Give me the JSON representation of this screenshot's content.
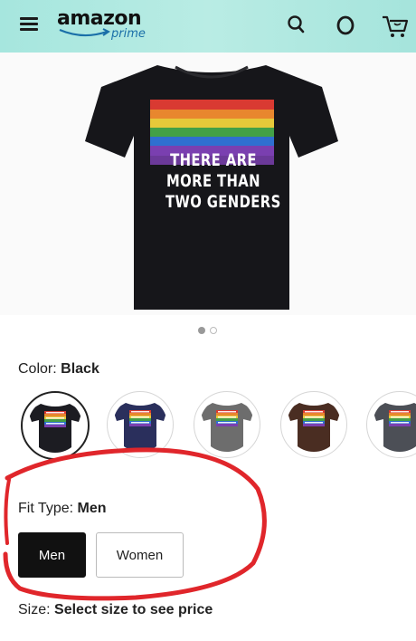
{
  "header": {
    "logo_word": "amazon",
    "logo_sub": "prime",
    "icons": [
      "menu-icon",
      "search-icon",
      "alexa-ring-icon",
      "cart-icon"
    ]
  },
  "product_image": {
    "shirt_text": [
      "THERE ARE",
      "MORE THAN",
      "TWO GENDERS"
    ],
    "carousel": {
      "count": 2,
      "active_index": 0
    }
  },
  "color": {
    "label": "Color:",
    "value": "Black",
    "swatches": [
      {
        "name": "Black",
        "hex": "#1c1c22",
        "selected": true
      },
      {
        "name": "Navy",
        "hex": "#2a2f5c",
        "selected": false
      },
      {
        "name": "Gray",
        "hex": "#6d6d6d",
        "selected": false
      },
      {
        "name": "Brown",
        "hex": "#4a2d22",
        "selected": false
      },
      {
        "name": "Dark Gray",
        "hex": "#4c4f56",
        "selected": false
      }
    ]
  },
  "fit_type": {
    "label": "Fit Type:",
    "value": "Men",
    "options": [
      {
        "label": "Men",
        "selected": true
      },
      {
        "label": "Women",
        "selected": false
      }
    ]
  },
  "size": {
    "label": "Size:",
    "value": "Select size to see price"
  },
  "colors": {
    "header_bg": "#b2e9e1",
    "annotation": "#e0262b",
    "selected_button": "#111111"
  }
}
